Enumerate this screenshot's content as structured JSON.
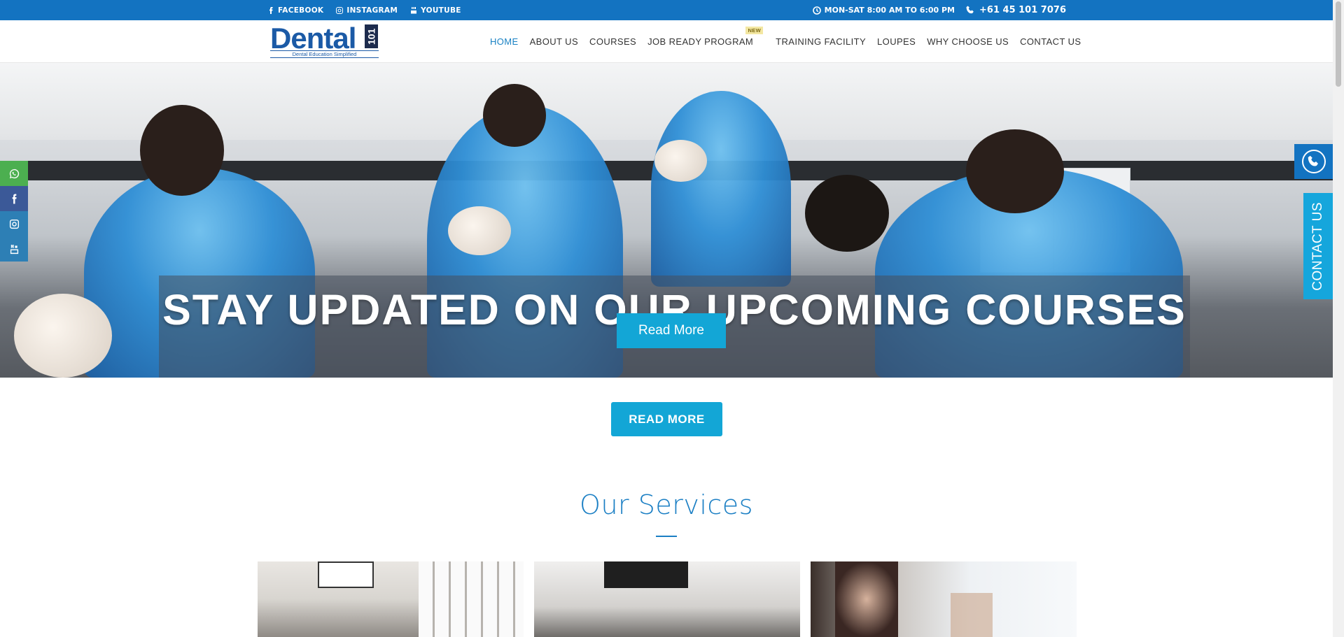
{
  "topbar": {
    "social": [
      {
        "label": "FACEBOOK",
        "icon": "facebook-icon"
      },
      {
        "label": "INSTAGRAM",
        "icon": "instagram-icon"
      },
      {
        "label": "YOUTUBE",
        "icon": "youtube-icon"
      }
    ],
    "hours": "MON-SAT 8:00 AM TO 6:00 PM",
    "phone": "+61 45 101 7076"
  },
  "logo": {
    "word": "Dental",
    "number": "101",
    "tagline": "Dental Education Simplified"
  },
  "nav": {
    "items": [
      {
        "label": "HOME",
        "active": true
      },
      {
        "label": "ABOUT US"
      },
      {
        "label": "COURSES"
      },
      {
        "label": "JOB READY PROGRAM",
        "badge": "NEW"
      },
      {
        "label": "TRAINING FACILITY"
      },
      {
        "label": "LOUPES"
      },
      {
        "label": "WHY CHOOSE US"
      },
      {
        "label": "CONTACT US"
      }
    ]
  },
  "hero": {
    "headline": "STAY UPDATED ON OUR UPCOMING COURSES",
    "button": "Read More"
  },
  "rail": [
    {
      "icon": "whatsapp-icon",
      "color": "#4caf50"
    },
    {
      "icon": "facebook-icon",
      "color": "#3b5998"
    },
    {
      "icon": "instagram-icon",
      "color": "#2d7fb5"
    },
    {
      "icon": "youtube-icon",
      "color": "#2d7fb5"
    }
  ],
  "contact_tab": {
    "label": "CONTACT US"
  },
  "cta": {
    "label": "READ MORE"
  },
  "services": {
    "title": "Our Services"
  },
  "colors": {
    "brand_blue": "#1373c1",
    "accent_cyan": "#13a6d6",
    "title_blue": "#1b7fc4"
  }
}
